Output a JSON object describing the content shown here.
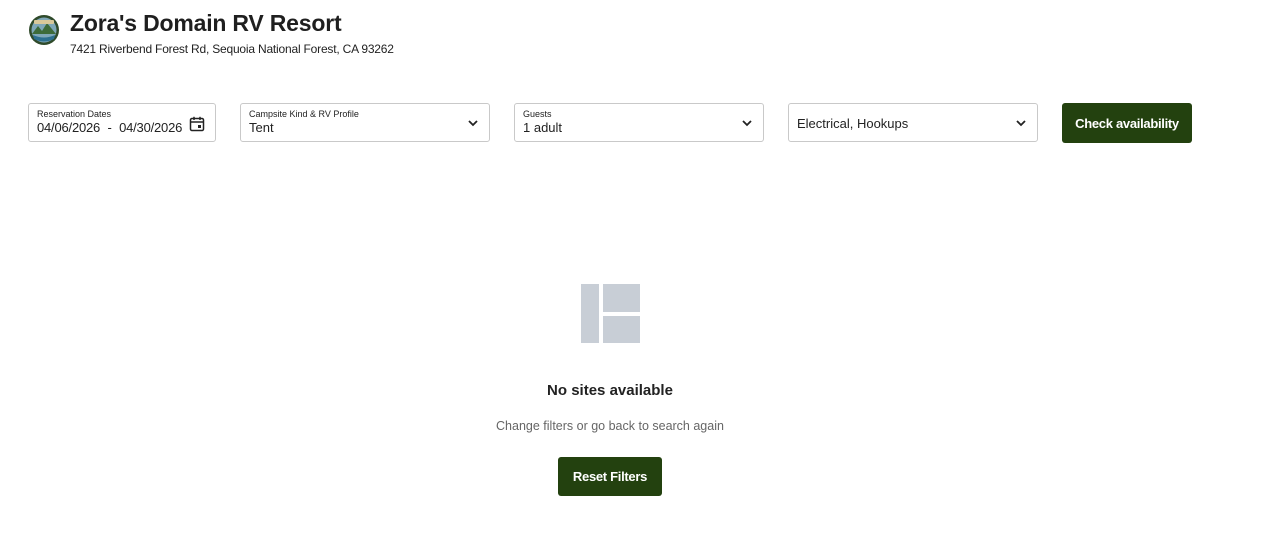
{
  "resort": {
    "name": "Zora's Domain RV Resort",
    "address": "7421 Riverbend Forest Rd, Sequoia National Forest, CA 93262",
    "logo_icon": "resort-badge-logo"
  },
  "filters": {
    "dates": {
      "label": "Reservation Dates",
      "start": "04/06/2026",
      "separator": "-",
      "end": "04/30/2026",
      "icon": "calendar-icon"
    },
    "campsite": {
      "label": "Campsite Kind & RV Profile",
      "value": "Tent"
    },
    "guests": {
      "label": "Guests",
      "value": "1 adult"
    },
    "amenities": {
      "value": "Electrical, Hookups"
    },
    "check_button": "Check availability"
  },
  "empty_state": {
    "icon": "layout-placeholder-icon",
    "title": "No sites available",
    "subtitle": "Change filters or go back to search again",
    "reset_button": "Reset Filters"
  },
  "colors": {
    "primary_button": "#23410f",
    "placeholder_icon": "#c8ced6",
    "field_border": "#c9c9c9"
  }
}
